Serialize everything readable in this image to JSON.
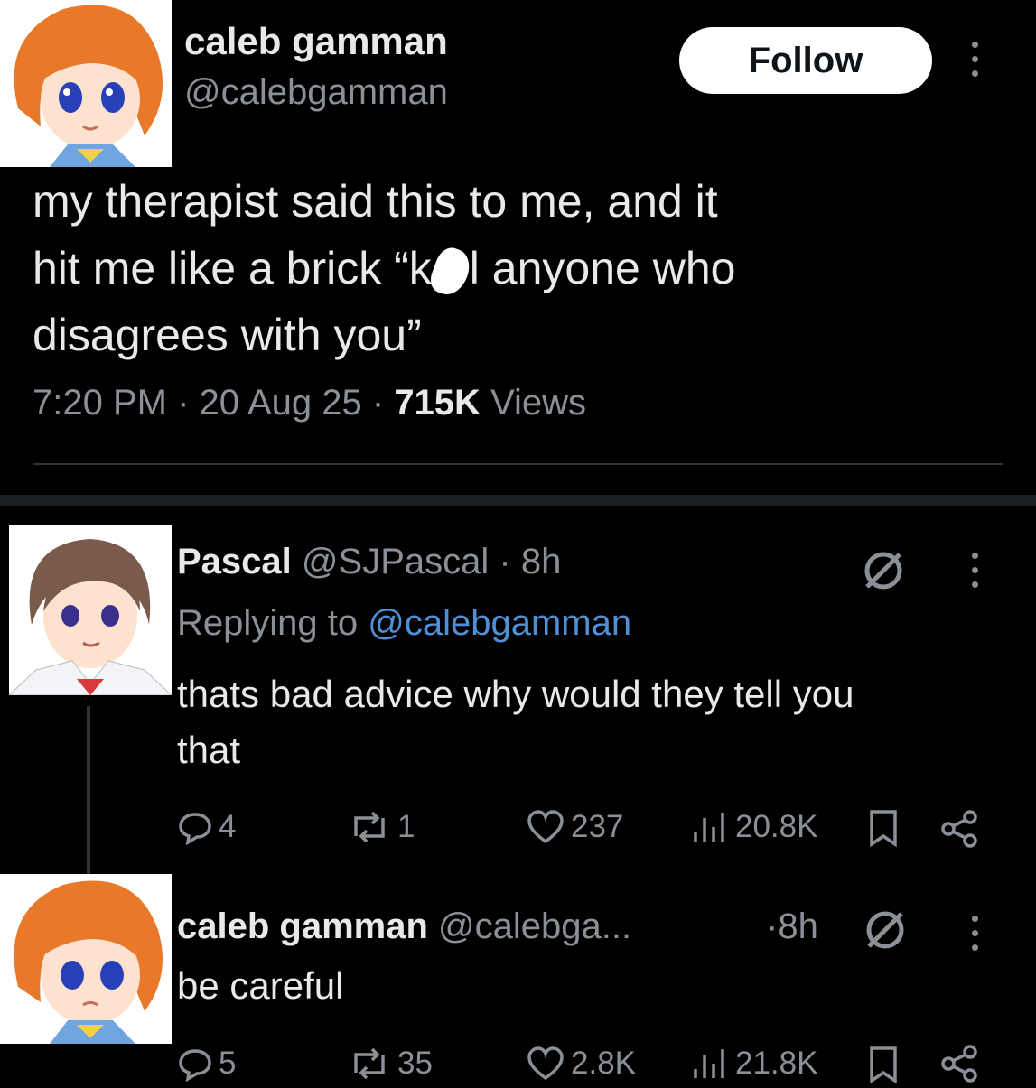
{
  "tweet": {
    "author_name": "caleb gamman",
    "author_handle": "@calebgamman",
    "follow_label": "Follow",
    "text_line1": "my therapist said this to me, and it",
    "text_line2_a": "hit me like a brick “k",
    "text_line2_b": "l anyone who",
    "text_line3": "disagrees with you”",
    "time": "7:20 PM",
    "date": "20 Aug 25",
    "views_count": "715K",
    "views_label": "Views",
    "sep": "·"
  },
  "reply1": {
    "author_name": "Pascal",
    "author_handle": "@SJPascal",
    "time": "8h",
    "replying_prefix": "Replying to",
    "replying_handle": "@calebgamman",
    "text_line1": "thats bad advice why would they tell you",
    "text_line2": "that",
    "replies": "4",
    "reposts": "1",
    "likes": "237",
    "views": "20.8K"
  },
  "reply2": {
    "author_name": "caleb gamman",
    "author_handle": "@calebga...",
    "time": "8h",
    "text": "be careful",
    "replies": "5",
    "reposts": "35",
    "likes": "2.8K",
    "views": "21.8K"
  },
  "colors": {
    "background": "#000000",
    "text": "#e7e9ea",
    "muted": "#8b9096",
    "link": "#4f8fd6",
    "avatar_hair_orange": "#e8782a",
    "avatar_hair_brown": "#7a5a4a"
  },
  "icons": [
    "more-icon",
    "reply-icon",
    "repost-icon",
    "like-icon",
    "views-icon",
    "bookmark-icon",
    "share-icon",
    "hidden-reply-icon"
  ]
}
